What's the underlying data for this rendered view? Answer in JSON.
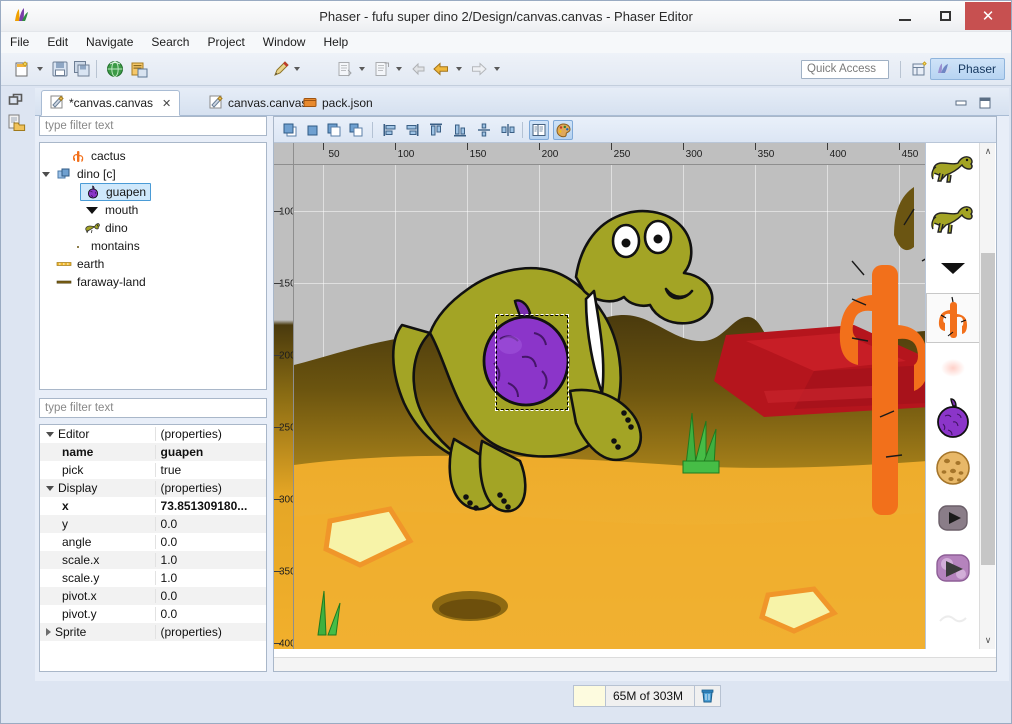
{
  "window": {
    "title": "Phaser - fufu super dino 2/Design/canvas.canvas - Phaser Editor",
    "app_icon": "phaser-logo-icon",
    "minimize_label": "—",
    "maximize_label": "❐",
    "close_label": "✕"
  },
  "menu": [
    "File",
    "Edit",
    "Navigate",
    "Search",
    "Project",
    "Window",
    "Help"
  ],
  "toolbar": {
    "items": [
      {
        "name": "new-wizard-icon",
        "dropdown": true
      },
      {
        "name": "save-icon",
        "dropdown": false
      },
      {
        "name": "save-all-icon",
        "dropdown": false
      },
      {
        "name": "open-browser-icon",
        "dropdown": false
      },
      {
        "name": "open-resource-icon",
        "dropdown": false
      },
      {
        "name": "run-icon",
        "dropdown": true
      },
      {
        "name": "new-java-class-icon",
        "dropdown": true
      },
      {
        "name": "new-java-package-icon",
        "dropdown": true
      },
      {
        "name": "back-history-icon",
        "dropdown": false
      },
      {
        "name": "back-icon",
        "dropdown": true
      },
      {
        "name": "forward-icon",
        "dropdown": true
      }
    ],
    "quick_access_placeholder": "Quick Access",
    "open-perspective-icon": "open-perspective-icon",
    "perspective": "Phaser"
  },
  "left_trim": [
    {
      "name": "restore-view-icon"
    },
    {
      "name": "project-explorer-icon"
    }
  ],
  "editor_tabs": {
    "tabs": [
      {
        "label": "*canvas.canvas",
        "icon": "canvas-file-icon",
        "active": true,
        "closable": true
      },
      {
        "label": "canvas.canvas",
        "icon": "canvas-file-icon",
        "active": false,
        "closable": false
      },
      {
        "label": "pack.json",
        "icon": "pack-file-icon",
        "active": false,
        "closable": false
      }
    ],
    "close_glyph": "✕",
    "minimize_view_label": "minimize",
    "maximize_view_label": "maximize"
  },
  "outline": {
    "filter_placeholder": "type filter text",
    "items": [
      {
        "label": "cactus",
        "icon": "cactus-sprite-icon",
        "indent": 1,
        "twisty": false,
        "selected": false
      },
      {
        "label": "dino [c]",
        "icon": "group-icon",
        "indent": 0,
        "twisty": true,
        "selected": false
      },
      {
        "label": "guapen",
        "icon": "guapen-sprite-icon",
        "indent": 2,
        "twisty": false,
        "selected": true
      },
      {
        "label": "mouth",
        "icon": "mouth-sprite-icon",
        "indent": 2,
        "twisty": false,
        "selected": false
      },
      {
        "label": "dino",
        "icon": "dino-sprite-icon",
        "indent": 2,
        "twisty": false,
        "selected": false
      },
      {
        "label": "montains",
        "icon": "montains-sprite-icon",
        "indent": 1,
        "twisty": false,
        "selected": false
      },
      {
        "label": "earth",
        "icon": "earth-sprite-icon",
        "indent": 0,
        "twisty": false,
        "selected": false
      },
      {
        "label": "faraway-land",
        "icon": "faraway-sprite-icon",
        "indent": 0,
        "twisty": false,
        "selected": false
      }
    ]
  },
  "properties": {
    "filter_placeholder": "type filter text",
    "rows": [
      {
        "key": "Editor",
        "value": "(properties)",
        "indent": 0,
        "twisty": "open",
        "bold": false
      },
      {
        "key": "name",
        "value": "guapen",
        "indent": 1,
        "twisty": "none",
        "bold": true
      },
      {
        "key": "pick",
        "value": "true",
        "indent": 1,
        "twisty": "none",
        "bold": false
      },
      {
        "key": "Display",
        "value": "(properties)",
        "indent": 0,
        "twisty": "open",
        "bold": false
      },
      {
        "key": "x",
        "value": "73.851309180...",
        "indent": 1,
        "twisty": "none",
        "bold": true
      },
      {
        "key": "y",
        "value": "0.0",
        "indent": 1,
        "twisty": "none",
        "bold": false
      },
      {
        "key": "angle",
        "value": "0.0",
        "indent": 1,
        "twisty": "none",
        "bold": false
      },
      {
        "key": "scale.x",
        "value": "1.0",
        "indent": 1,
        "twisty": "none",
        "bold": false
      },
      {
        "key": "scale.y",
        "value": "1.0",
        "indent": 1,
        "twisty": "none",
        "bold": false
      },
      {
        "key": "pivot.x",
        "value": "0.0",
        "indent": 1,
        "twisty": "none",
        "bold": false
      },
      {
        "key": "pivot.y",
        "value": "0.0",
        "indent": 1,
        "twisty": "none",
        "bold": false
      },
      {
        "key": "Sprite",
        "value": "(properties)",
        "indent": 0,
        "twisty": "closed",
        "bold": false
      }
    ]
  },
  "canvas": {
    "toolbar_items": [
      {
        "name": "bring-to-front-button"
      },
      {
        "name": "bring-forward-button"
      },
      {
        "name": "send-backward-button"
      },
      {
        "name": "send-to-back-button"
      },
      {
        "name": "align-left-button"
      },
      {
        "name": "align-right-button"
      },
      {
        "name": "align-top-button"
      },
      {
        "name": "align-bottom-button"
      },
      {
        "name": "align-center-horizontal-button"
      },
      {
        "name": "align-center-vertical-button"
      },
      {
        "name": "toggle-outline-button",
        "pressed": true
      },
      {
        "name": "toggle-palette-button",
        "pressed": true
      }
    ],
    "ruler_h_labels": [
      50,
      100,
      150,
      200,
      250,
      300,
      350,
      400,
      450
    ],
    "ruler_v_labels": [
      100,
      150,
      200,
      250,
      300,
      350,
      400
    ],
    "selection": {
      "object": "guapen"
    },
    "colors": {
      "sky": "#bfbfbf",
      "hills": "#5e4a14",
      "ground_top": "#8a6c13",
      "ground_bottom": "#f0ac26",
      "dino_body": "#a3a425",
      "guapen": "#8b35c9",
      "rock_red": "#b81b22",
      "cactus_orange": "#f2701b",
      "grass_green": "#3fb03f",
      "leaf_yellow": "#f5ef9c"
    }
  },
  "palette": {
    "items": [
      {
        "name": "dino-walk-sprite",
        "selected": false
      },
      {
        "name": "dino-idle-sprite",
        "selected": false
      },
      {
        "name": "mouth-sprite",
        "selected": false
      },
      {
        "name": "cactus-sprite",
        "selected": true
      },
      {
        "name": "glow-sprite",
        "selected": false
      },
      {
        "name": "guapen-sprite",
        "selected": false
      },
      {
        "name": "cookie-sprite",
        "selected": false
      },
      {
        "name": "button-grey-sprite",
        "selected": false
      },
      {
        "name": "button-purple-sprite",
        "selected": false
      },
      {
        "name": "faint-sprite",
        "selected": false
      },
      {
        "name": "legs-sprite",
        "selected": false
      }
    ],
    "scroll_up_glyph": "∧",
    "scroll_down_glyph": "∨"
  },
  "status": {
    "heap_text": "65M of 303M",
    "gc_icon": "trash-icon"
  }
}
